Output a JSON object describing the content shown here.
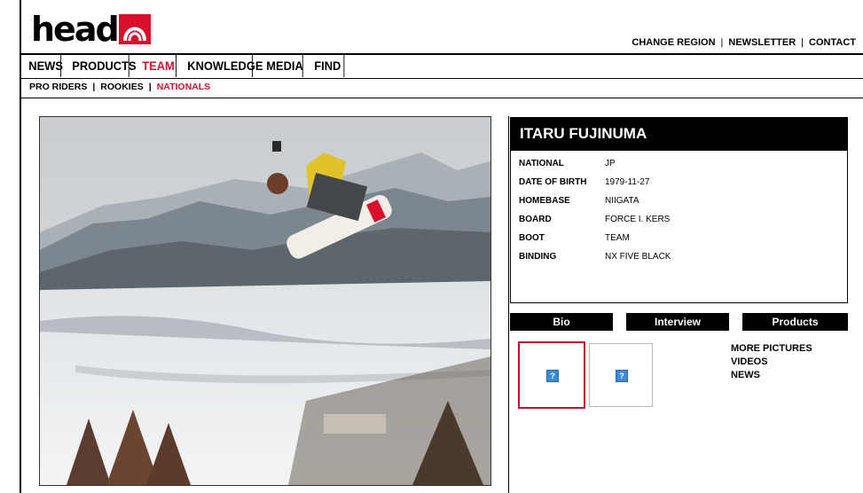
{
  "brand": {
    "logo_text": "head",
    "accent": "#d8102c"
  },
  "utility_nav": {
    "items": [
      "CHANGE REGION",
      "NEWSLETTER",
      "CONTACT"
    ]
  },
  "main_nav": {
    "items": [
      "NEWS",
      "PRODUCTS",
      "TEAM",
      "KNOWLEDGE",
      "MEDIA",
      "FIND"
    ],
    "active": "TEAM"
  },
  "sub_nav": {
    "items": [
      "PRO RIDERS",
      "ROOKIES",
      "NATIONALS"
    ],
    "active": "NATIONALS"
  },
  "rider": {
    "name": "ITARU FUJINUMA",
    "fields": [
      {
        "label": "NATIONAL",
        "value": "JP"
      },
      {
        "label": "DATE OF BIRTH",
        "value": "1979-11-27"
      },
      {
        "label": "HOMEBASE",
        "value": "NIIGATA"
      },
      {
        "label": "BOARD",
        "value": "FORCE I. KERS"
      },
      {
        "label": "BOOT",
        "value": "TEAM"
      },
      {
        "label": "BINDING",
        "value": "NX FIVE BLACK"
      }
    ]
  },
  "tabs": [
    "Bio",
    "Interview",
    "Products"
  ],
  "thumbnails": {
    "placeholder_glyph": "?"
  },
  "media_links": [
    "MORE PICTURES",
    "VIDEOS",
    "NEWS"
  ]
}
